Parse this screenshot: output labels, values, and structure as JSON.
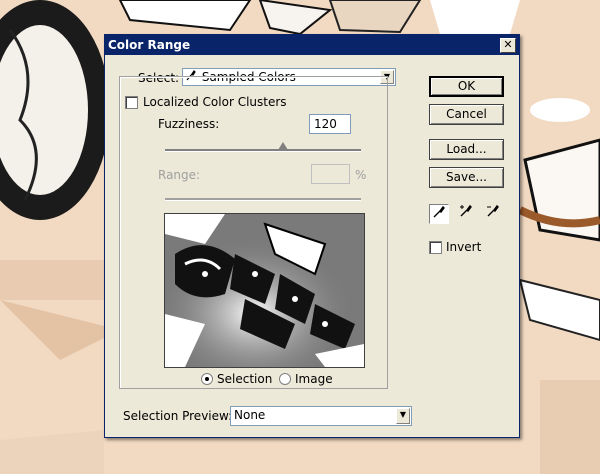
{
  "dialog": {
    "title": "Color Range",
    "close_glyph": "✕"
  },
  "select": {
    "label": "Select:",
    "value": "Sampled Colors"
  },
  "localized": {
    "label": "Localized Color Clusters",
    "checked": false
  },
  "fuzziness": {
    "label": "Fuzziness:",
    "value": "120",
    "slider_fraction": 0.6
  },
  "range": {
    "label": "Range:",
    "value": "",
    "unit": "%"
  },
  "preview": {
    "mode_selection": "Selection",
    "mode_image": "Image",
    "selected": "Selection"
  },
  "selection_preview": {
    "label": "Selection Preview:",
    "value": "None"
  },
  "buttons": {
    "ok": "OK",
    "cancel": "Cancel",
    "load": "Load...",
    "save": "Save..."
  },
  "invert": {
    "label": "Invert",
    "checked": false
  },
  "icons": {
    "eyedropper": "eyedropper-icon",
    "eyedropper_plus": "eyedropper-plus-icon",
    "eyedropper_minus": "eyedropper-minus-icon"
  },
  "colors": {
    "titlebar": "#0a246a",
    "dialog_bg": "#ece9d8"
  }
}
